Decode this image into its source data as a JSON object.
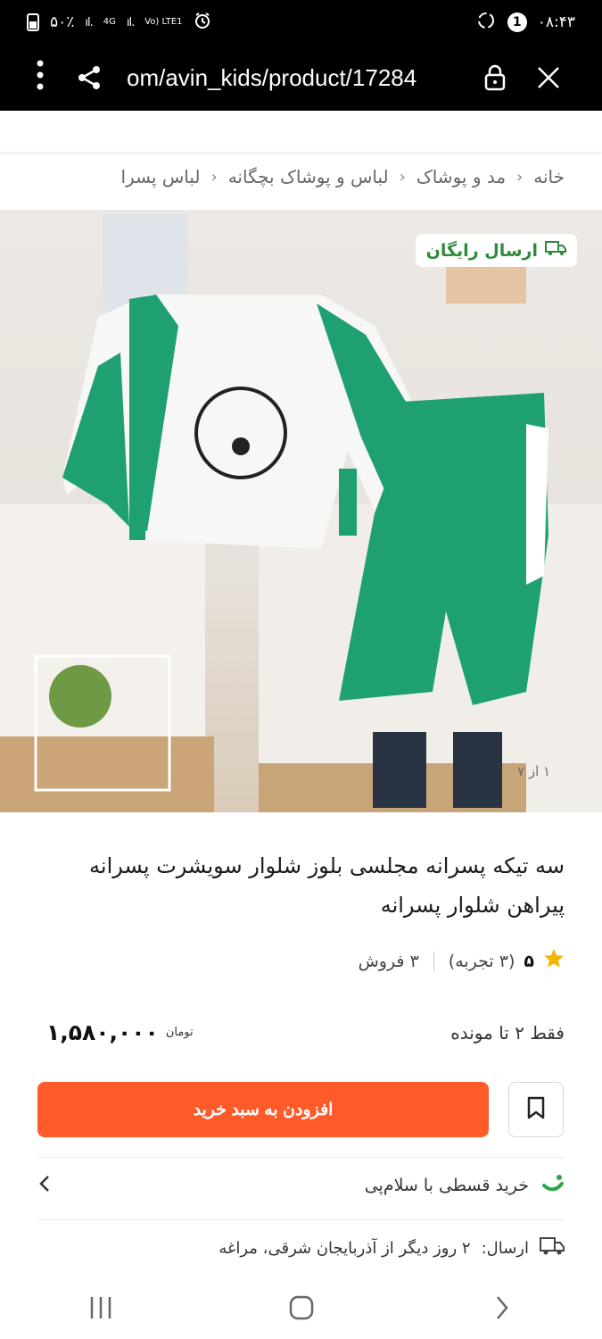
{
  "status_bar": {
    "battery_percent": "۵۰٪",
    "network_1": "ıl.",
    "network_2": "4G",
    "network_3": "ıl.",
    "volte": "Vo) LTE1",
    "notification_count": "1",
    "time": "۰۸:۴۳"
  },
  "browser": {
    "url": "om/avin_kids/product/17284"
  },
  "breadcrumb": {
    "items": [
      "خانه",
      "مد و پوشاک",
      "لباس و پوشاک بچگانه",
      "لباس پسرا"
    ]
  },
  "product": {
    "free_shipping_badge": "ارسال رایگان",
    "image_counter": "۱ از ۷",
    "title": "سه تیکه پسرانه مجلسی بلوز شلوار سویشرت پسرانه پیراهن شلوار پسرانه",
    "rating": "۵",
    "reviews": "(۳ تجربه)",
    "sales": "۳ فروش",
    "stock_note": "فقط ۲ تا مونده",
    "price": "۱,۵۸۰,۰۰۰",
    "currency": "تومان",
    "add_to_cart": "افزودن به سبد خرید"
  },
  "installment": {
    "text": "خرید قسطی با سلام‌پی"
  },
  "delivery": {
    "label": "ارسال:",
    "text": "۲ روز دیگر از آذربایجان شرقی، مراغه"
  },
  "colors": {
    "accent": "#ff5b2a",
    "success": "#2e8b3d",
    "garment_green": "#1fa071"
  }
}
